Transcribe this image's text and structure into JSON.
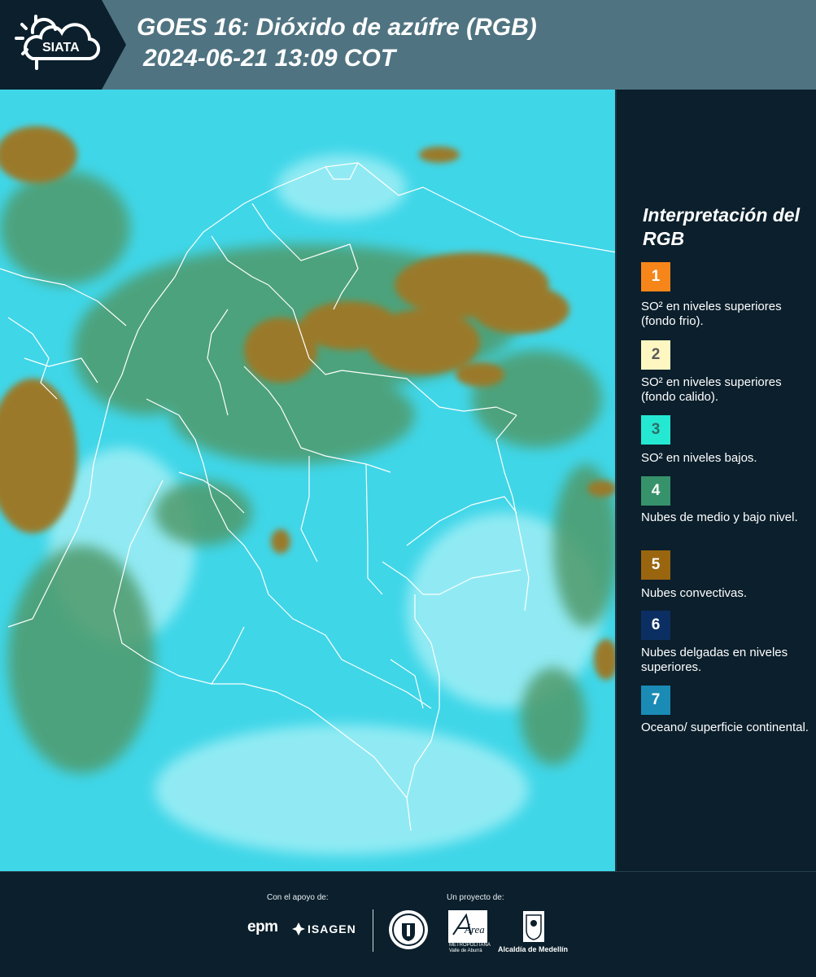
{
  "header": {
    "logo_text": "SIATA",
    "title_line1": "GOES 16: Dióxido de azúfre (RGB)",
    "title_line2": "2024-06-21 13:09 COT"
  },
  "map": {
    "description_icon": "satellite-rgb-map",
    "colors": {
      "ocean": "#3fd6e8",
      "convective": "#9a7a2c",
      "midlow": "#4f9a6a",
      "border": "#ffffff"
    }
  },
  "legend": {
    "title": "Interpretación del RGB",
    "items": [
      {
        "num": "1",
        "color": "#f7861a",
        "text_color": "#ffffff",
        "label": "SO² en niveles superiores (fondo frio)."
      },
      {
        "num": "2",
        "color": "#fff7c2",
        "text_color": "#5a5a5a",
        "label": "SO² en niveles superiores (fondo calido)."
      },
      {
        "num": "3",
        "color": "#25e8d3",
        "text_color": "#2d6e66",
        "label": "SO² en niveles bajos."
      },
      {
        "num": "4",
        "color": "#36926a",
        "text_color": "#ffffff",
        "label": "Nubes de medio y bajo nivel."
      },
      {
        "num": "5",
        "color": "#9a650f",
        "text_color": "#ffffff",
        "label": "Nubes convectivas."
      },
      {
        "num": "6",
        "color": "#0c2f63",
        "text_color": "#ffffff",
        "label": "Nubes delgadas en niveles superiores."
      },
      {
        "num": "7",
        "color": "#1a8bb5",
        "text_color": "#ffffff",
        "label": "Oceano/ superficie continental."
      }
    ]
  },
  "footer": {
    "support_label": "Con el apoyo de:",
    "project_label": "Un proyecto de:",
    "epm": "epm",
    "isagen": "ISAGEN",
    "area_name": "Área",
    "area_sub1": "METROPOLITANA",
    "area_sub2": "Valle de Aburrá",
    "alcaldia": "Alcaldía de Medellín"
  }
}
